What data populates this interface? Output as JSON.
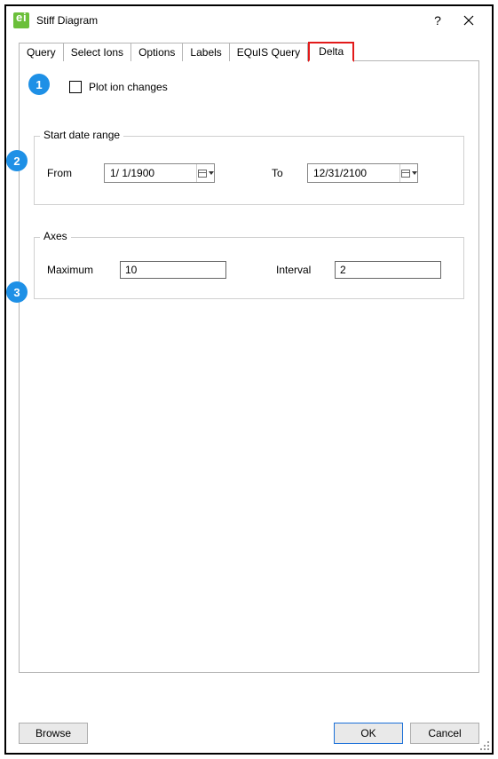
{
  "window": {
    "title": "Stiff Diagram"
  },
  "tabs": {
    "t0": "Query",
    "t1": "Select Ions",
    "t2": "Options",
    "t3": "Labels",
    "t4": "EQuIS Query",
    "t5": "Delta"
  },
  "delta": {
    "plot_ion_changes_label": "Plot ion changes",
    "start_group_label": "Start date range",
    "from_label": "From",
    "to_label": "To",
    "from_value": "1/  1/1900",
    "to_value": "12/31/2100",
    "axes_group_label": "Axes",
    "maximum_label": "Maximum",
    "interval_label": "Interval",
    "maximum_value": "10",
    "interval_value": "2"
  },
  "buttons": {
    "browse": "Browse",
    "ok": "OK",
    "cancel": "Cancel"
  },
  "annot": {
    "n1": "1",
    "n2": "2",
    "n3": "3"
  }
}
